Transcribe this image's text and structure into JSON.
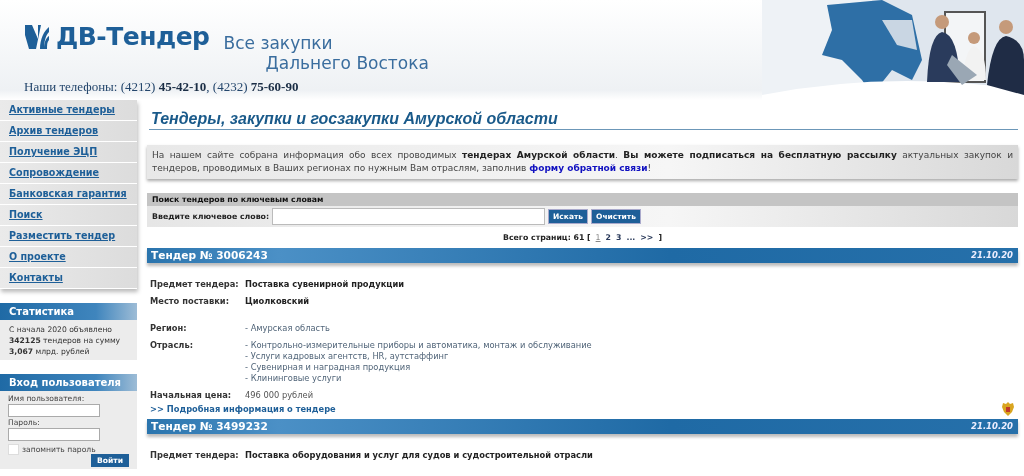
{
  "header": {
    "logo": "ДВ-Тендер",
    "slogan_line_1": "Все закупки",
    "slogan_line_2": "Дальнего Востока",
    "phones": "Наши телефоны: (4212) **45-42-10**, (4232) **75-60-90**"
  },
  "sidebar": {
    "items": [
      {
        "label": "Активные тендеры"
      },
      {
        "label": "Архив тендеров"
      },
      {
        "label": "Получение ЭЦП"
      },
      {
        "label": "Сопровождение"
      },
      {
        "label": "Банковская гарантия"
      },
      {
        "label": "Поиск"
      },
      {
        "label": "Разместить тендер"
      },
      {
        "label": "О проекте"
      },
      {
        "label": "Контакты"
      }
    ],
    "stats": {
      "title": "Статистика",
      "text": "С начала 2020 объявлено **342125** тендеров на сумму **3,067** млрд. рублей"
    },
    "login": {
      "title": "Вход пользователя",
      "username_label": "Имя пользователя:",
      "password_label": "Пароль:",
      "remember_label": "запомнить пароль",
      "remember_checked": false,
      "button": "Войти"
    }
  },
  "main": {
    "title": "Тендеры, закупки и госзакупки Амурской области",
    "intro": {
      "before": "На нашем сайте собрана информация обо всех проводимых **тендерах Амурской области**. **Вы можете подписаться на бесплатную рассылку** актуальных закупок и тендеров, проводимых в Ваших регионах по нужным Вам отраслям, заполнив",
      "link": "форму обратной связи",
      "after": "!"
    },
    "search": {
      "title": "Поиск тендеров по ключевым словам",
      "label": "Введите ключевое слово:",
      "buttons": [
        "Искать",
        "Очистить"
      ]
    },
    "pagination": {
      "label": "Всего страниц: 61 [",
      "pages": [
        {
          "label": "1",
          "selected": true
        },
        {
          "label": "2",
          "selected": false
        },
        {
          "label": "3",
          "selected": false
        },
        {
          "label": "...",
          "selected": false
        },
        {
          "label": ">>",
          "selected": false
        }
      ],
      "close": "]"
    },
    "tenders": [
      {
        "title": "Тендер № 3006243",
        "date": "21.10.20",
        "emblem": true,
        "fields": [
          {
            "kind": "text",
            "label": "Предмет тендера:",
            "value": "Поставка сувенирной продукции"
          },
          {
            "kind": "text",
            "label": "Место поставки:",
            "value": "Циолковский"
          },
          {
            "kind": "list",
            "label": "Регион:",
            "items": [
              "- Амурская область"
            ]
          },
          {
            "kind": "list",
            "label": "Отрасль:",
            "items": [
              "- Контрольно-измерительные приборы и автоматика, монтаж и обслуживание",
              "- Услуги кадровых агентств, HR, аутстаффинг",
              "- Сувенирная и наградная продукция",
              "- Клининговые услуги"
            ]
          },
          {
            "kind": "price",
            "label": "Начальная цена:",
            "value": "496 000 рублей"
          }
        ],
        "link": ">> Подробная информация о тендере"
      },
      {
        "title": "Тендер № 3499232",
        "date": "21.10.20",
        "emblem": false,
        "fields": [
          {
            "kind": "text",
            "label": "Предмет тендера:",
            "value": "Поставка оборудования и услуг для судов и судостроительной отрасли"
          }
        ]
      }
    ]
  }
}
